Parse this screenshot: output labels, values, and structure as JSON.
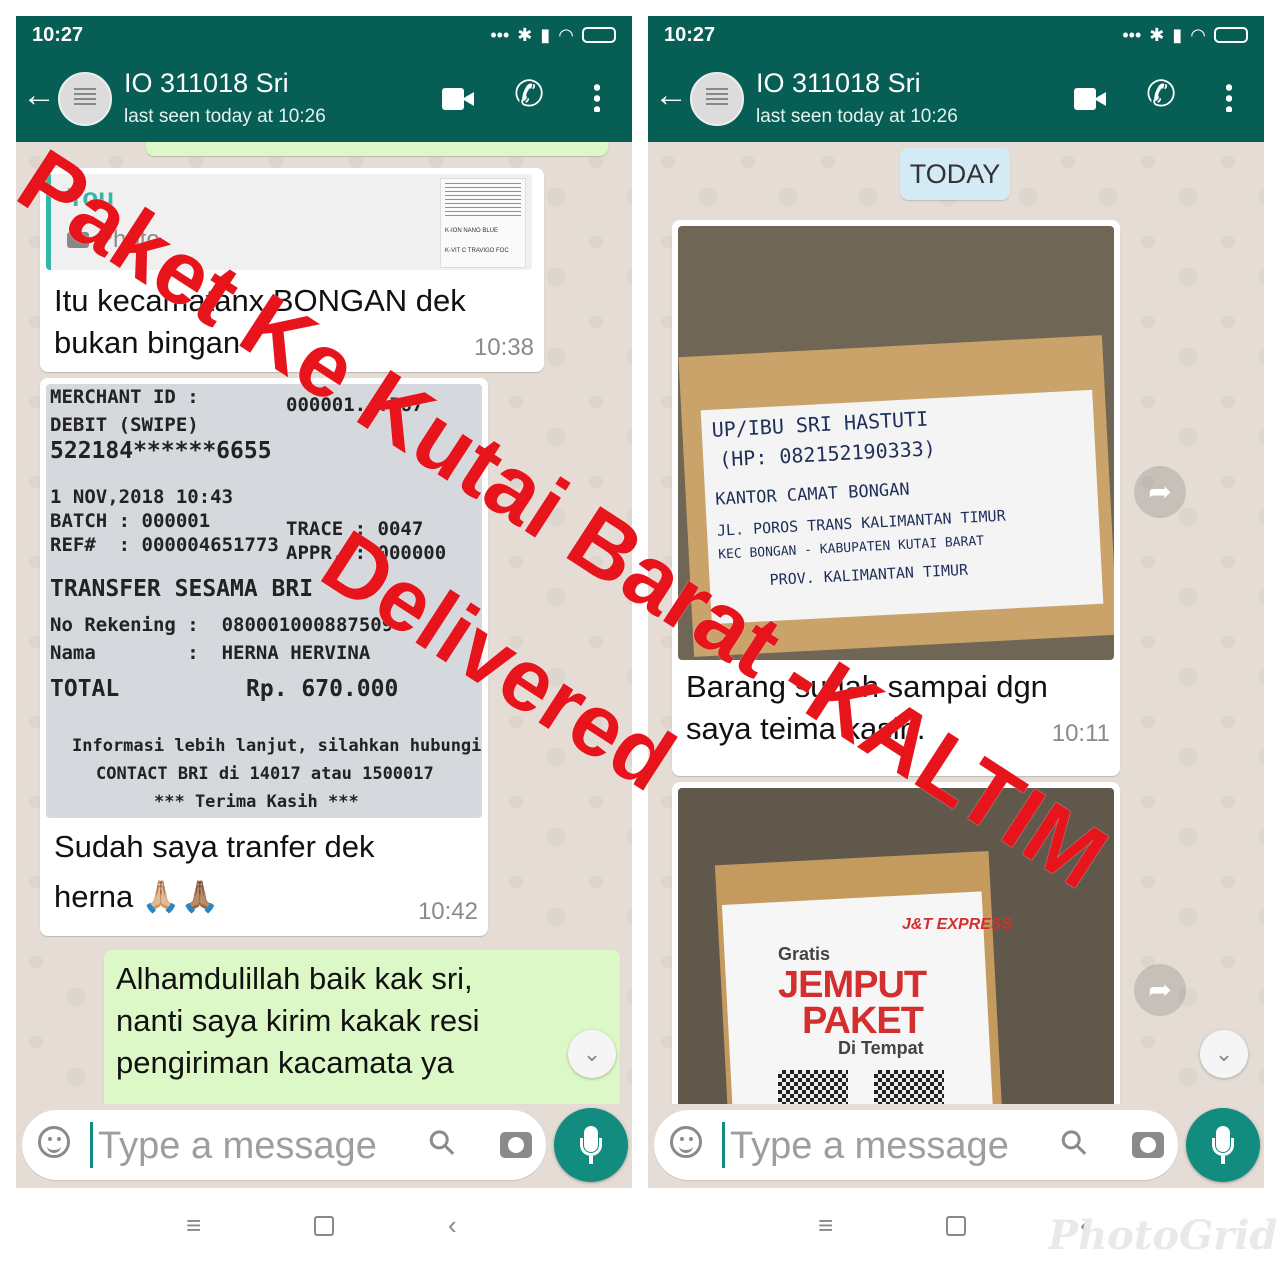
{
  "status_bar": {
    "time": "10:27"
  },
  "chat_header": {
    "contact_name": "IO 311018 Sri",
    "last_seen": "last seen today at 10:26"
  },
  "left_chat": {
    "reply_quote": {
      "author": "You",
      "label": "Photo"
    },
    "quote_thumb_lines": [
      "K-ION NANO BLUE",
      "K-VIT C TRAVIGO FOC"
    ],
    "msg1": {
      "text_line1": "Itu kecamatanx BONGAN dek",
      "text_line2": "bukan bingan",
      "time": "10:38"
    },
    "receipt": {
      "merchant": "MERCHANT ID :",
      "merchant_id": "000001...567",
      "debit": "DEBIT (SWIPE)",
      "card": "522184******6655",
      "date": "1 NOV,2018 10:43",
      "batch": "BATCH : 000001",
      "trace": "TRACE : 0047",
      "ref": "REF#  : 000004651773",
      "appr": "APPR. : 000000",
      "transfer": "TRANSFER SESAMA BRI",
      "rekening": "No Rekening :  080001000887509",
      "nama": "Nama        :  HERNA HERVINA",
      "total_label": "TOTAL",
      "total_value": "Rp. 670.000",
      "info1": "Informasi lebih lanjut, silahkan hubungi",
      "info2": "CONTACT BRI di 14017 atau 1500017",
      "info3": "*** Terima Kasih ***"
    },
    "msg2": {
      "text_line1": "Sudah saya tranfer dek",
      "text_line2": "herna 🙏🏼🙏🏽",
      "time": "10:42"
    },
    "msg3": {
      "text_line1": "Alhamdulillah baik kak sri,",
      "text_line2": "nanti saya kirim kakak resi",
      "text_line3": "pengiriman kacamata ya"
    }
  },
  "right_chat": {
    "date_chip": "TODAY",
    "package_label": [
      "UP/IBU SRI HASTUTI",
      "(HP: 082152190333)",
      "KANTOR CAMAT BONGAN",
      "JL. POROS TRANS KALIMANTAN TIMUR",
      "KEC BONGAN - KABUPATEN KUTAI BARAT",
      "PROV. KALIMANTAN TIMUR"
    ],
    "msg1": {
      "text_line1": "Barang sudah sampai dgn",
      "text_line2": "saya teima kasih.",
      "time": "10:11"
    },
    "flyer": {
      "brand": "J&T EXPRESS",
      "gratis": "Gratis",
      "jemput": "JEMPUT",
      "paket": "PAKET",
      "di_tempat": "Di Tempat"
    }
  },
  "input": {
    "placeholder": "Type a message"
  },
  "overlay": {
    "line1": "Paket Ke Kutai Barat -KALTIM",
    "line2": "Delivered"
  },
  "watermark": "PhotoGrid",
  "colors": {
    "header": "#075e54",
    "outgoing_bubble": "#dcf8c6",
    "mic_button": "#128c7e",
    "overlay_text": "#e8141c"
  }
}
